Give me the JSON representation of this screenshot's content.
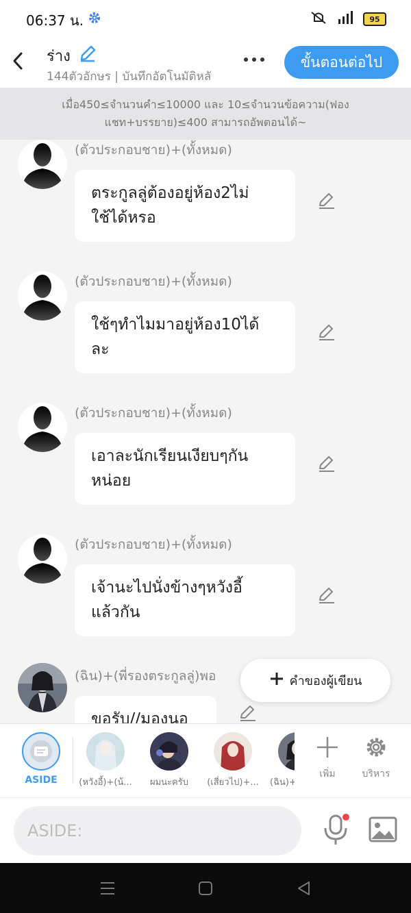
{
  "status": {
    "time": "06:37 น.",
    "battery": "95"
  },
  "header": {
    "title": "ร่าง",
    "subtitle": "144ตัวอักษร | บันทึกอัตโนมัติหลั",
    "next_label": "ขั้นตอนต่อไป"
  },
  "notice": {
    "line1": "เมื่อ450≤จำนวนคำ≤10000 และ 10≤จำนวนข้อความ(ฟอง",
    "line2": "แชท+บรรยาย)≤400 สามารถอัพตอนได้~"
  },
  "messages": [
    {
      "sender": "(ตัวประกอบชาย)+(ทั้งหมด)",
      "line1": "ตระกูลลู่ต้องอยู่ห้อง2ไม่",
      "line2": "ใช้ได้หรอ"
    },
    {
      "sender": "(ตัวประกอบชาย)+(ทั้งหมด)",
      "line1": "ใช้ๆทำไมมาอยู่ห้อง10ได้",
      "line2": "ละ"
    },
    {
      "sender": "(ตัวประกอบชาย)+(ทั้งหมด)",
      "line1": "เอาละนักเรียนเงียบๆกัน",
      "line2": "หน่อย"
    },
    {
      "sender": "(ตัวประกอบชาย)+(ทั้งหมด)",
      "line1": "เจ้านะไปนั่งข้างๆหวังอี้",
      "line2": "แล้วกัน"
    },
    {
      "sender": "(ฉิน)+(พี่รองตระกูลลู่)พอ",
      "line1": "ขอรับ//มองนอ",
      "line2": ""
    }
  ],
  "author_button": {
    "label": "คำของผู้เขียน"
  },
  "characters": [
    {
      "label": "ASIDE",
      "active": true
    },
    {
      "label": "(หวังอี้)+(น้..."
    },
    {
      "label": "ผมนะครับ"
    },
    {
      "label": "(เสี่ยวไป)+..."
    },
    {
      "label": "(ฉิน)+"
    }
  ],
  "tools": {
    "add_label": "เพิ่ม",
    "manage_label": "บริหาร"
  },
  "input": {
    "placeholder": "ASIDE:"
  },
  "colors": {
    "accent": "#3d9bf0",
    "aside_active": "#3d9bf0",
    "mic_dot": "#f0444a"
  }
}
